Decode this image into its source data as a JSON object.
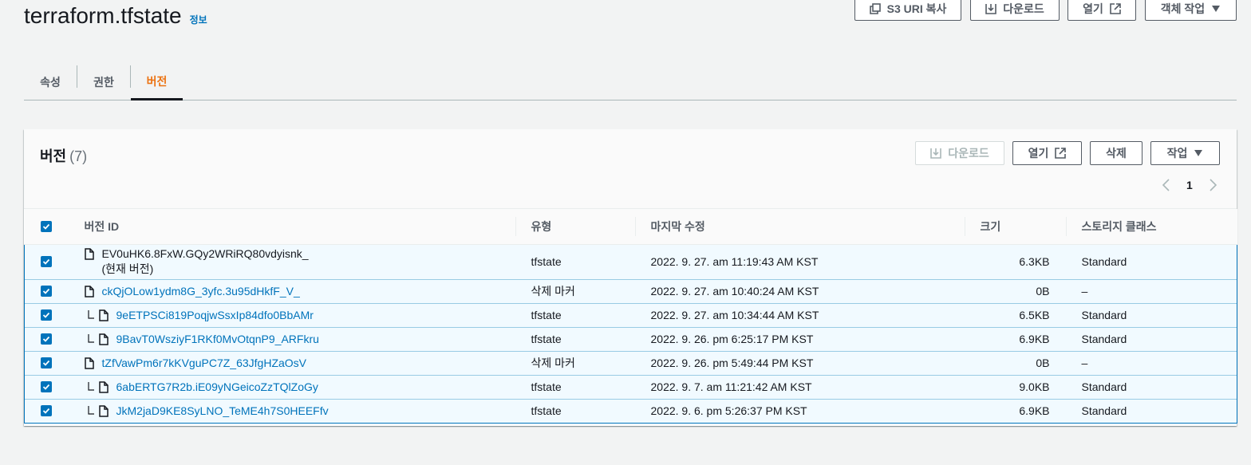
{
  "header": {
    "title": "terraform.tfstate",
    "info_label": "정보",
    "buttons": {
      "copy_s3_uri": "S3 URI 복사",
      "download": "다운로드",
      "open": "열기",
      "object_actions": "객체 작업"
    }
  },
  "tabs": [
    {
      "label": "속성"
    },
    {
      "label": "권한"
    },
    {
      "label": "버전"
    }
  ],
  "versions_panel": {
    "title": "버전",
    "count": "(7)",
    "buttons": {
      "download": "다운로드",
      "open": "열기",
      "delete": "삭제",
      "actions": "작업"
    },
    "page": "1",
    "columns": [
      "버전 ID",
      "유형",
      "마지막 수정",
      "크기",
      "스토리지 클래스"
    ],
    "rows": [
      {
        "version_id": "EV0uHK6.8FxW.GQy2WRiRQ80vdyisnk_",
        "sub_label": "(현재 버전)",
        "type": "tfstate",
        "modified": "2022. 9. 27. am 11:19:43 AM KST",
        "size": "6.3KB",
        "storage_class": "Standard"
      },
      {
        "version_id": "ckQjOLow1ydm8G_3yfc.3u95dHkfF_V_",
        "type": "삭제 마커",
        "modified": "2022. 9. 27. am 10:40:24 AM KST",
        "size": "0B",
        "storage_class": "–"
      },
      {
        "version_id": "9eETPSCi819PoqjwSsxIp84dfo0BbAMr",
        "type": "tfstate",
        "modified": "2022. 9. 27. am 10:34:44 AM KST",
        "size": "6.5KB",
        "storage_class": "Standard"
      },
      {
        "version_id": "9BavT0WsziyF1RKf0MvOtqnP9_ARFkru",
        "type": "tfstate",
        "modified": "2022. 9. 26. pm 6:25:17 PM KST",
        "size": "6.9KB",
        "storage_class": "Standard"
      },
      {
        "version_id": "tZfVawPm6r7kKVguPC7Z_63JfgHZaOsV",
        "type": "삭제 마커",
        "modified": "2022. 9. 26. pm 5:49:44 PM KST",
        "size": "0B",
        "storage_class": "–"
      },
      {
        "version_id": "6abERTG7R2b.iE09yNGeicoZzTQlZoGy",
        "type": "tfstate",
        "modified": "2022. 9. 7. am 11:21:42 AM KST",
        "size": "9.0KB",
        "storage_class": "Standard"
      },
      {
        "version_id": "JkM2jaD9KE8SyLNO_TeME4h7S0HEEFfv",
        "type": "tfstate",
        "modified": "2022. 9. 6. pm 5:26:37 PM KST",
        "size": "6.9KB",
        "storage_class": "Standard"
      }
    ]
  },
  "colors": {
    "link": "#0073bb",
    "active_tab": "#ec7211",
    "selected_row_bg": "#f1faff"
  }
}
